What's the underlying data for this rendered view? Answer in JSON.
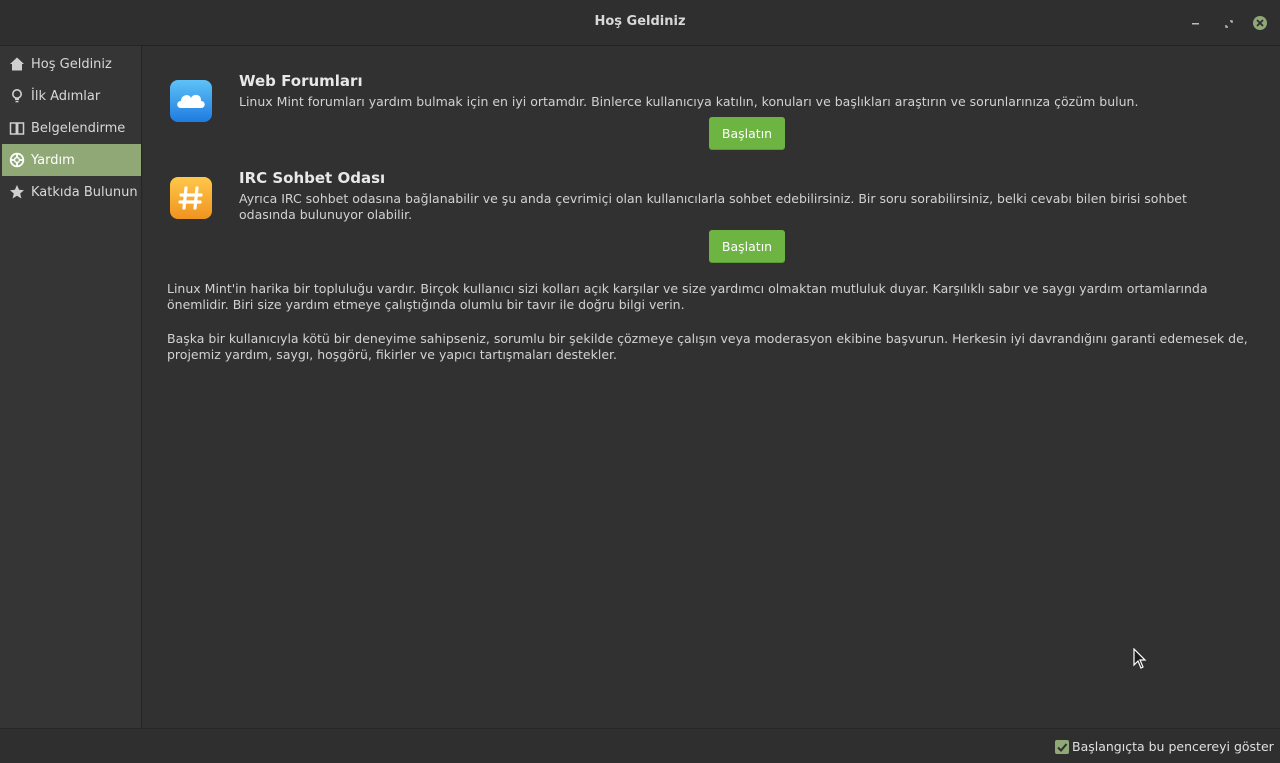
{
  "window": {
    "title": "Hoş Geldiniz",
    "close_color": "#8fa876"
  },
  "sidebar": {
    "items": [
      {
        "label": "Hoş Geldiniz",
        "icon": "home-icon"
      },
      {
        "label": "İlk Adımlar",
        "icon": "lightbulb-icon"
      },
      {
        "label": "Belgelendirme",
        "icon": "book-icon"
      },
      {
        "label": "Yardım",
        "icon": "lifebuoy-icon",
        "active": true
      },
      {
        "label": "Katkıda Bulunun",
        "icon": "star-icon"
      }
    ],
    "active_color": "#8fa876"
  },
  "main": {
    "sections": [
      {
        "title": "Web Forumları",
        "description": "Linux Mint forumları yardım bulmak için en iyi ortamdır. Binlerce kullanıcıya katılın, konuları ve başlıkları araştırın ve sorunlarınıza çözüm bulun.",
        "button": "Başlatın",
        "icon": "cloud-icon"
      },
      {
        "title": "IRC Sohbet Odası",
        "description": "Ayrıca IRC sohbet odasına bağlanabilir ve şu anda çevrimiçi olan kullanıcılarla sohbet edebilirsiniz. Bir soru sorabilirsiniz, belki cevabı bilen birisi sohbet odasında bulunuyor olabilir.",
        "button": "Başlatın",
        "icon": "hash-icon"
      }
    ],
    "paragraphs": [
      "Linux Mint'in harika bir topluluğu vardır. Birçok kullanıcı sizi kolları açık karşılar ve size yardımcı olmaktan mutluluk duyar. Karşılıklı sabır ve saygı yardım ortamlarında önemlidir. Biri size yardım etmeye çalıştığında olumlu bir tavır ile doğru bilgi verin.",
      "Başka bir kullanıcıyla kötü bir deneyime sahipseniz, sorumlu bir şekilde çözmeye çalışın veya moderasyon ekibine başvurun. Herkesin iyi davrandığını garanti edemesek de, projemiz yardım, saygı, hoşgörü, fikirler ve yapıcı tartışmaları destekler."
    ],
    "button_color": "#6db442"
  },
  "footer": {
    "checkbox_label": "Başlangıçta bu pencereyi göster",
    "checked": true
  }
}
